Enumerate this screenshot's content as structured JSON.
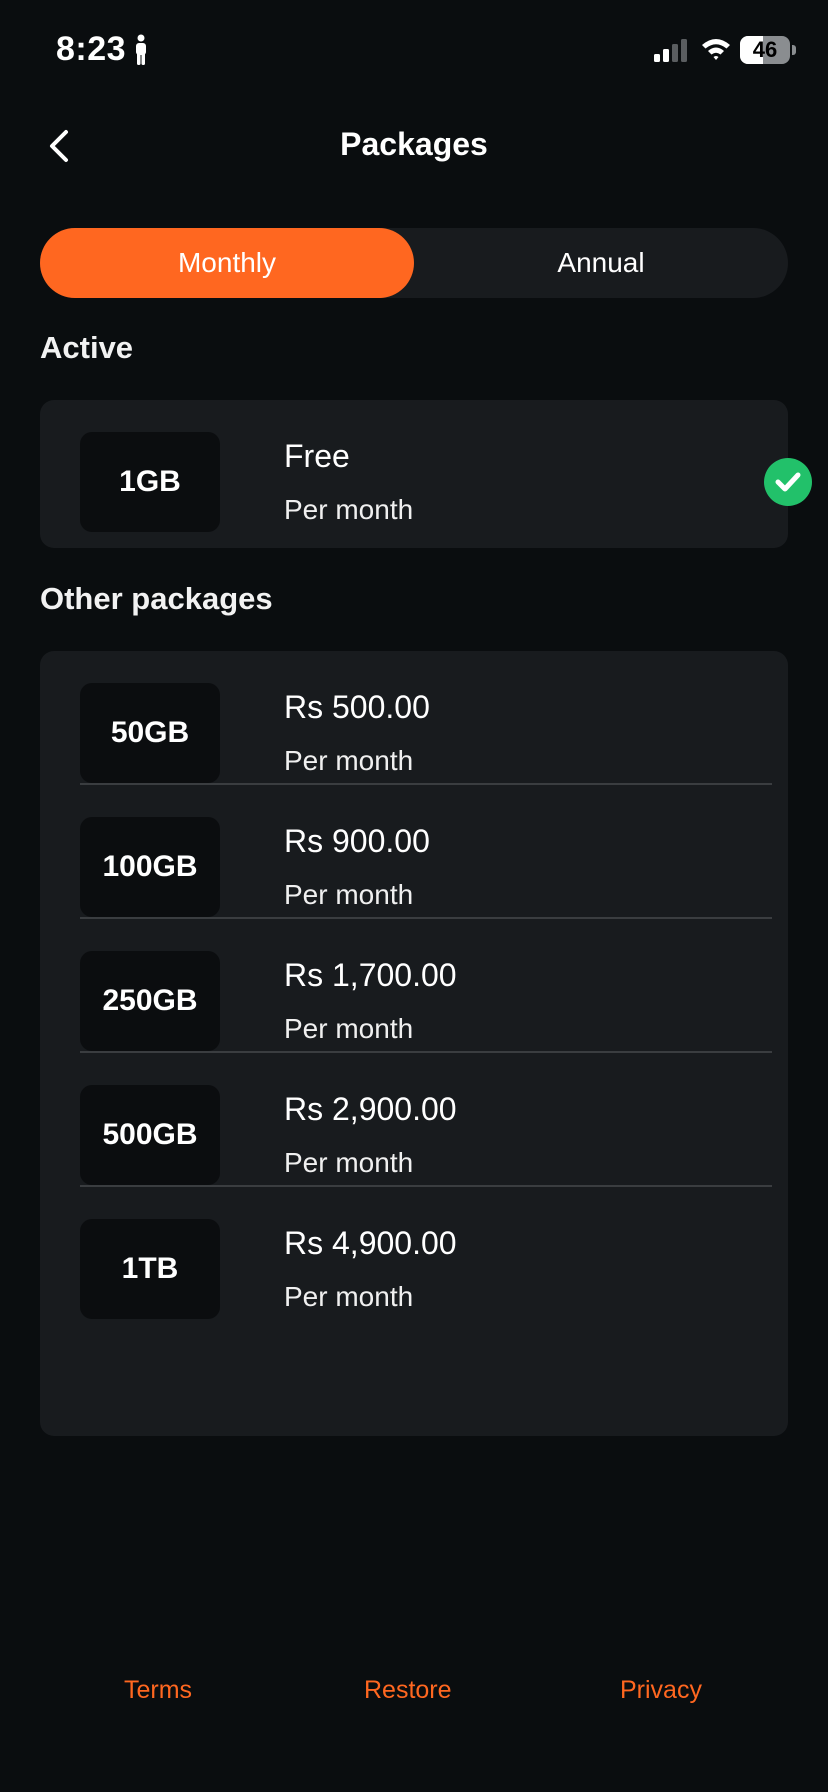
{
  "status_bar": {
    "time": "8:23",
    "battery_level": "46",
    "battery_fraction": 0.46
  },
  "header": {
    "title": "Packages",
    "back_icon": "chevron-left-icon"
  },
  "billing_toggle": {
    "options": [
      "Monthly",
      "Annual"
    ],
    "selected": "Monthly",
    "accent_color": "#ff6720"
  },
  "active_section": {
    "label": "Active",
    "package": {
      "size": "1GB",
      "price": "Free",
      "period": "Per month",
      "status_icon": "check-circle-icon",
      "status_color": "#22c16a"
    }
  },
  "other_section": {
    "label": "Other packages",
    "packages": [
      {
        "size": "50GB",
        "price": "Rs 500.00",
        "period": "Per month"
      },
      {
        "size": "100GB",
        "price": "Rs 900.00",
        "period": "Per month"
      },
      {
        "size": "250GB",
        "price": "Rs 1,700.00",
        "period": "Per month"
      },
      {
        "size": "500GB",
        "price": "Rs 2,900.00",
        "period": "Per month"
      },
      {
        "size": "1TB",
        "price": "Rs 4,900.00",
        "period": "Per month"
      }
    ]
  },
  "footer": {
    "terms": "Terms",
    "restore": "Restore",
    "privacy": "Privacy"
  }
}
